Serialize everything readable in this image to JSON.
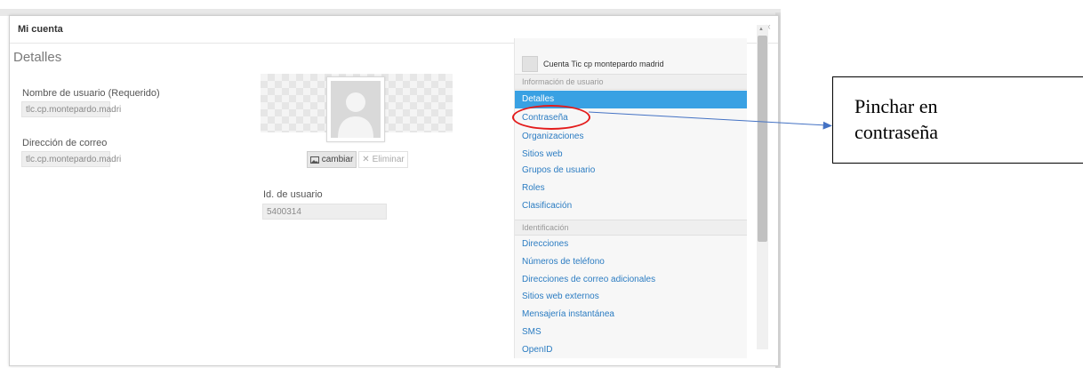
{
  "modal": {
    "title": "Mi cuenta",
    "close": "×"
  },
  "details": {
    "heading": "Detalles",
    "username_label": "Nombre de usuario (Requerido)",
    "username_value": "tlc.cp.montepardo.madri",
    "email_label": "Dirección de correo",
    "email_value": "tlc.cp.montepardo.madri"
  },
  "photo": {
    "change_button": "cambiar",
    "delete_button": "Eliminar",
    "userid_label": "Id. de usuario",
    "userid_value": "5400314"
  },
  "nav": {
    "account_name": "Cuenta Tic cp montepardo madrid",
    "section_user_info": "Información de usuario",
    "user_info_items": [
      "Detalles",
      "Contraseña",
      "Organizaciones",
      "Sitios web",
      "Grupos de usuario",
      "Roles",
      "Clasificación"
    ],
    "section_identification": "Identificación",
    "identification_items": [
      "Direcciones",
      "Números de teléfono",
      "Direcciones de correo adicionales",
      "Sitios web externos",
      "Mensajería instantánea",
      "SMS",
      "OpenID"
    ],
    "active_item": "Detalles"
  },
  "annotation": {
    "line1": "Pinchar en",
    "line2": "contraseña",
    "highlight_color": "#e31b1b",
    "arrow_color": "#4472c4"
  },
  "colors": {
    "accent": "#39a1e3",
    "link": "#2b7cc2"
  }
}
